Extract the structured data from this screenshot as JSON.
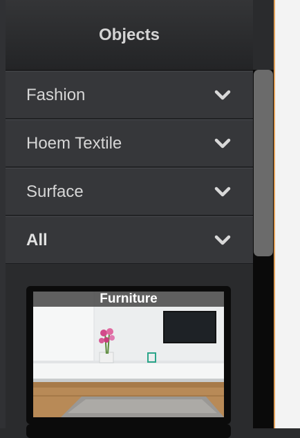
{
  "panel": {
    "title": "Objects"
  },
  "accordion": {
    "items": [
      {
        "label": "Fashion",
        "icon": "chevron-down-icon"
      },
      {
        "label": "Hoem Textile",
        "icon": "chevron-down-icon"
      },
      {
        "label": "Surface",
        "icon": "chevron-down-icon"
      },
      {
        "label": "All",
        "icon": "chevron-down-icon"
      }
    ]
  },
  "thumbnails": [
    {
      "caption": "Furniture"
    }
  ],
  "colors": {
    "panel_bg": "#2b2c2e",
    "item_bg": "#36373a",
    "text": "#d6d6d6",
    "canvas_border": "#e2a15a"
  }
}
